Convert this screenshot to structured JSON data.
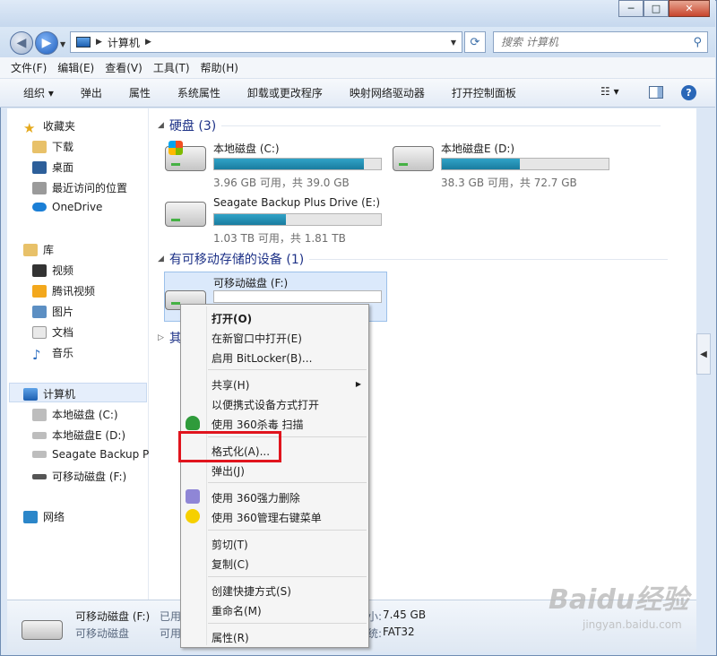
{
  "window": {
    "minimize": "─",
    "maximize": "□",
    "close": "✕"
  },
  "address": {
    "path": "计算机",
    "search_placeholder": "搜索 计算机"
  },
  "menubar": [
    "文件(F)",
    "编辑(E)",
    "查看(V)",
    "工具(T)",
    "帮助(H)"
  ],
  "toolbar": [
    "组织 ▾",
    "弹出",
    "属性",
    "系统属性",
    "卸载或更改程序",
    "映射网络驱动器",
    "打开控制面板"
  ],
  "sidebar": {
    "favorites": {
      "title": "收藏夹",
      "items": [
        "下载",
        "桌面",
        "最近访问的位置",
        "OneDrive"
      ]
    },
    "libraries": {
      "title": "库",
      "items": [
        "视频",
        "腾讯视频",
        "图片",
        "文档",
        "音乐"
      ]
    },
    "computer": {
      "title": "计算机",
      "items": [
        "本地磁盘 (C:)",
        "本地磁盘E (D:)",
        "Seagate Backup P",
        "可移动磁盘 (F:)"
      ]
    },
    "network": {
      "title": "网络"
    }
  },
  "groups": {
    "hdd": "硬盘 (3)",
    "removable": "有可移动存储的设备 (1)",
    "other": "其"
  },
  "drives": [
    {
      "name": "本地磁盘 (C:)",
      "stat": "3.96 GB 可用，共 39.0 GB",
      "used_fraction": 0.9
    },
    {
      "name": "本地磁盘E (D:)",
      "stat": "38.3 GB 可用，共 72.7 GB",
      "used_fraction": 0.47
    },
    {
      "name": "Seagate Backup Plus Drive (E:)",
      "stat": "1.03 TB 可用，共 1.81 TB",
      "used_fraction": 0.43
    },
    {
      "name": "可移动磁盘 (F:)",
      "stat": "",
      "used_fraction": 0
    }
  ],
  "context_menu": [
    "打开(O)",
    "在新窗口中打开(E)",
    "启用 BitLocker(B)...",
    "共享(H)",
    "以便携式设备方式打开",
    "使用 360杀毒 扫描",
    "格式化(A)...",
    "弹出(J)",
    "使用 360强力删除",
    "使用 360管理右键菜单",
    "剪切(T)",
    "复制(C)",
    "创建快捷方式(S)",
    "重命名(M)",
    "属性(R)"
  ],
  "statusbar": {
    "name": "可移动磁盘 (F:)",
    "type": "可移动磁盘",
    "used_label": "已用",
    "free_label": "可用",
    "size_label": "小:",
    "size_value": "7.45 GB",
    "fs_label": "统:",
    "fs_value": "FAT32"
  },
  "watermark": {
    "logo": "Baidu经验",
    "url": "jingyan.baidu.com"
  },
  "colors": {
    "accent": "#1e3287",
    "bar_fill": "#1a7c9f",
    "highlight": "#e0141d"
  }
}
